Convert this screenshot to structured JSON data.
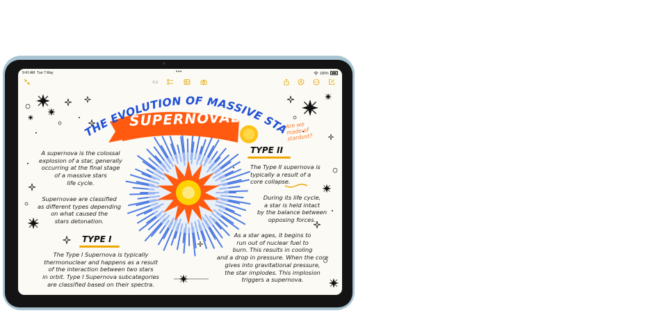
{
  "status_bar": {
    "time": "9:41 AM",
    "date": "Tue 7 May",
    "dots": "•••",
    "battery": "100%"
  },
  "toolbar": {
    "format_label": "Aa"
  },
  "note": {
    "title_arc": "THE EVOLUTION OF MASSIVE STARS:",
    "banner": "SUPERNOVAE",
    "question": [
      "Are we",
      "made of",
      "stardust?"
    ],
    "intro": [
      "A supernova is the colossal",
      "explosion of a star, generally",
      "occurring at the final stage",
      "of a massive stars",
      "life cycle."
    ],
    "classified": [
      "Supernovae are classified",
      "as different types depending",
      "on what caused the",
      "stars detonation."
    ],
    "type1_heading": "TYPE I",
    "type1_text": [
      "The Type I Supernova is typically",
      "thermonuclear and happens as a result",
      "of the interaction between two stars",
      "in orbit. Type I Supernova subcategories",
      "are classified based on their spectra."
    ],
    "type2_heading": "TYPE II",
    "type2_text": [
      "The Type II supernova is",
      "typically a result of a",
      "core collapse."
    ],
    "lifecycle": [
      "During its life cycle,",
      "a star is held intact",
      "by the balance between",
      "opposing forces."
    ],
    "aging": [
      "As a star ages, it begins to",
      "run out of nuclear fuel to",
      "burn. This results in cooling",
      "and a drop in pressure. When the core",
      "gives into gravitational pressure,",
      "the star implodes. This implosion",
      "triggers a supernova."
    ]
  },
  "colors": {
    "accent": "#e2a400",
    "banner": "#ff5a10",
    "title_blue": "#1f4fd6",
    "sun_yellow": "#ffd100"
  }
}
